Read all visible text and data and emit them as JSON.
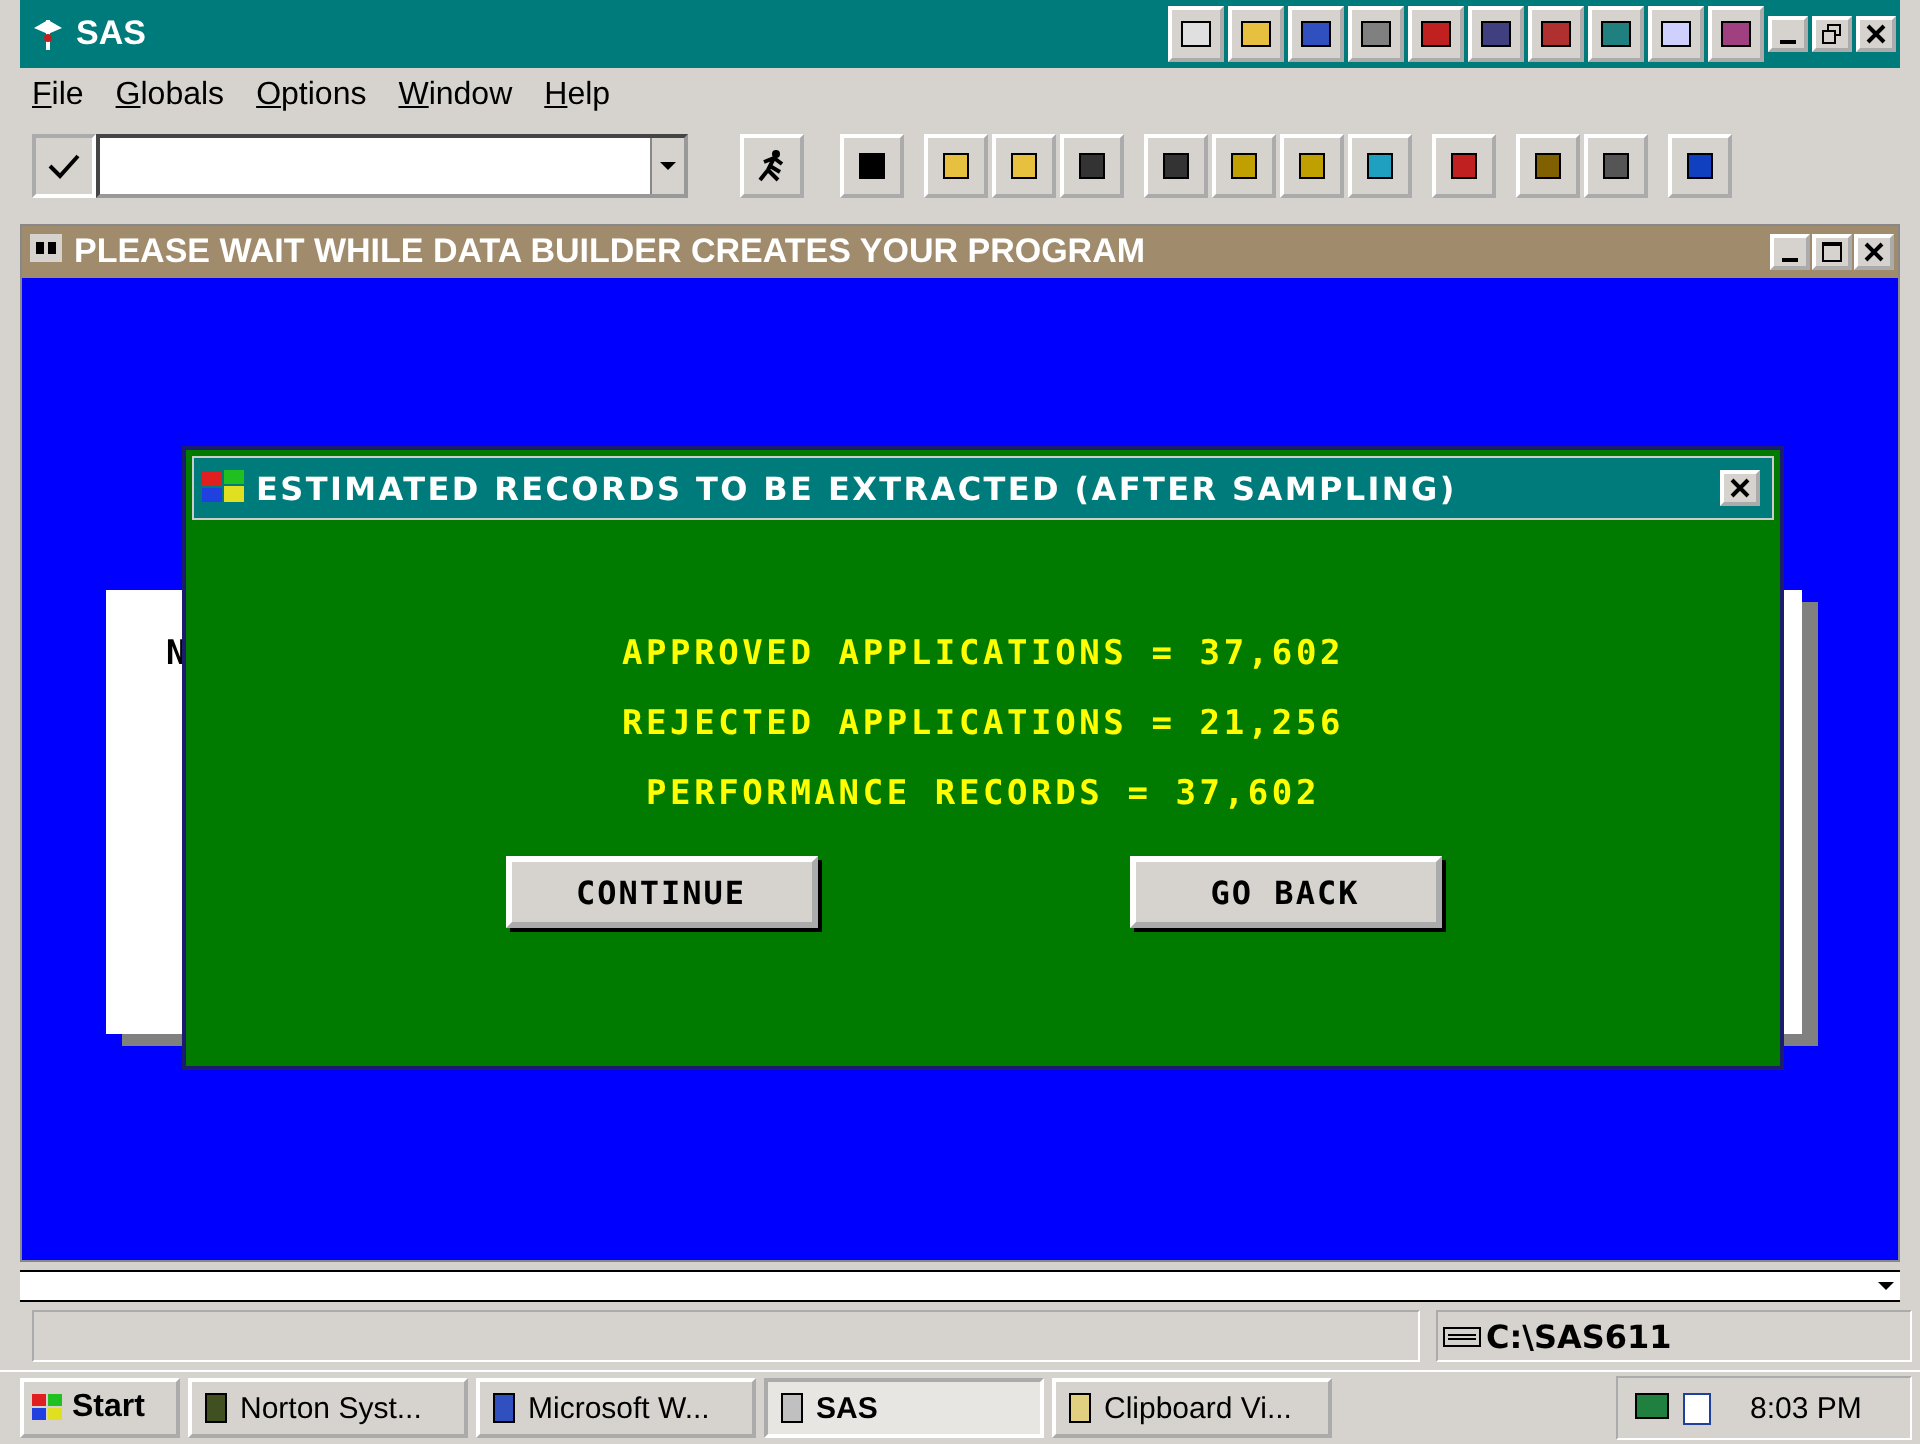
{
  "window": {
    "title": "SAS"
  },
  "menu": [
    {
      "label": "File"
    },
    {
      "label": "Globals"
    },
    {
      "label": "Options"
    },
    {
      "label": "Window"
    },
    {
      "label": "Help"
    }
  ],
  "inner_window": {
    "title": "PLEASE WAIT WHILE DATA BUILDER CREATES YOUR PROGRAM",
    "behind_panel_text": "N"
  },
  "dialog": {
    "title": "ESTIMATED RECORDS TO BE EXTRACTED (AFTER SAMPLING)",
    "lines": [
      "APPROVED APPLICATIONS = 37,602",
      "REJECTED APPLICATIONS = 21,256",
      "PERFORMANCE RECORDS = 37,602"
    ],
    "buttons": [
      "CONTINUE",
      "GO BACK"
    ]
  },
  "status_bar": {
    "path": "C:\\SAS611"
  },
  "taskbar": {
    "start": "Start",
    "tasks": [
      {
        "label": "Norton Syst...",
        "selected": false
      },
      {
        "label": "Microsoft W...",
        "selected": false
      },
      {
        "label": "SAS",
        "selected": true
      },
      {
        "label": "Clipboard Vi...",
        "selected": false
      }
    ],
    "clock": "8:03 PM"
  }
}
